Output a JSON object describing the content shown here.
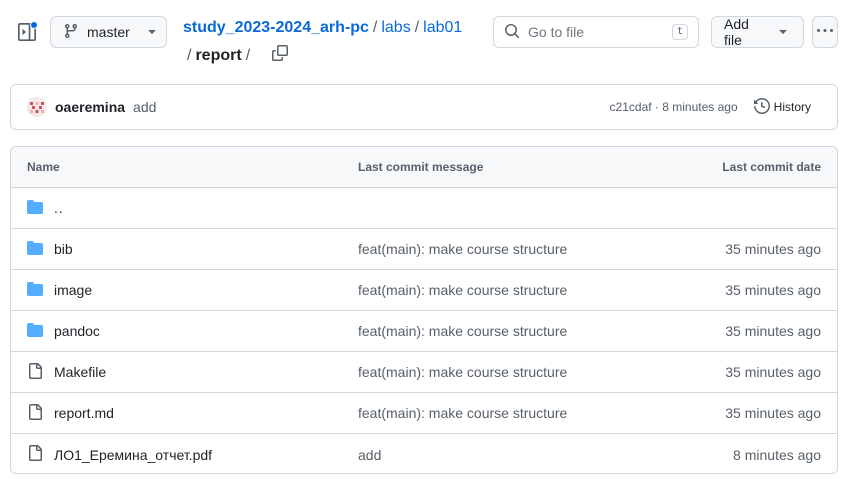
{
  "toolbar": {
    "branch_label": "master",
    "search_placeholder": "Go to file",
    "search_shortcut": "t",
    "add_file_label": "Add file"
  },
  "breadcrumb": {
    "repo": "study_2023-2024_arh-pc",
    "sep": "/",
    "parts": [
      "labs",
      "lab01"
    ],
    "current": "report"
  },
  "latest_commit": {
    "author": "oaeremina",
    "message": "add",
    "sha": "c21cdaf",
    "meta_sep": "·",
    "time": "8 minutes ago",
    "history_label": "History"
  },
  "table": {
    "headers": {
      "name": "Name",
      "message": "Last commit message",
      "date": "Last commit date"
    },
    "parent_dir": "..",
    "rows": [
      {
        "type": "folder",
        "name": "bib",
        "message": "feat(main): make course structure",
        "date": "35 minutes ago"
      },
      {
        "type": "folder",
        "name": "image",
        "message": "feat(main): make course structure",
        "date": "35 minutes ago"
      },
      {
        "type": "folder",
        "name": "pandoc",
        "message": "feat(main): make course structure",
        "date": "35 minutes ago"
      },
      {
        "type": "file",
        "name": "Makefile",
        "message": "feat(main): make course structure",
        "date": "35 minutes ago"
      },
      {
        "type": "file",
        "name": "report.md",
        "message": "feat(main): make course structure",
        "date": "35 minutes ago"
      },
      {
        "type": "file",
        "name": "ЛО1_Еремина_отчет.pdf",
        "message": "add",
        "date": "8 minutes ago"
      }
    ]
  },
  "colors": {
    "accent": "#0969da",
    "folder": "#54aeff",
    "border": "#d0d7de",
    "muted": "#57606a"
  }
}
